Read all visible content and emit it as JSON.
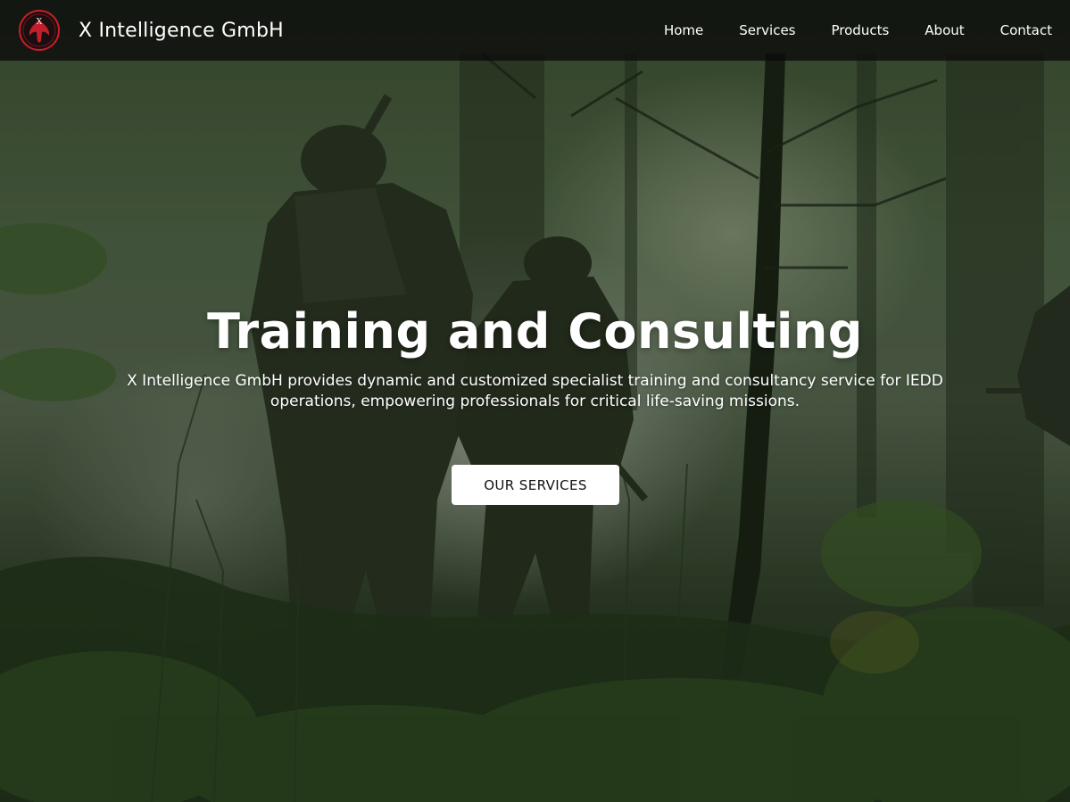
{
  "header": {
    "brand_name": "X Intelligence GmbH",
    "logo_letter": "X",
    "logo_color": "#c21f2b"
  },
  "nav": {
    "items": [
      {
        "label": "Home"
      },
      {
        "label": "Services"
      },
      {
        "label": "Products"
      },
      {
        "label": "About"
      },
      {
        "label": "Contact"
      }
    ]
  },
  "hero": {
    "title": "Training and Consulting",
    "subtitle": "X Intelligence GmbH provides dynamic and customized specialist training and consultancy service for IEDD operations, empowering professionals for critical life-saving missions.",
    "cta_label": "OUR SERVICES",
    "background": "forest-soldiers-photo"
  }
}
